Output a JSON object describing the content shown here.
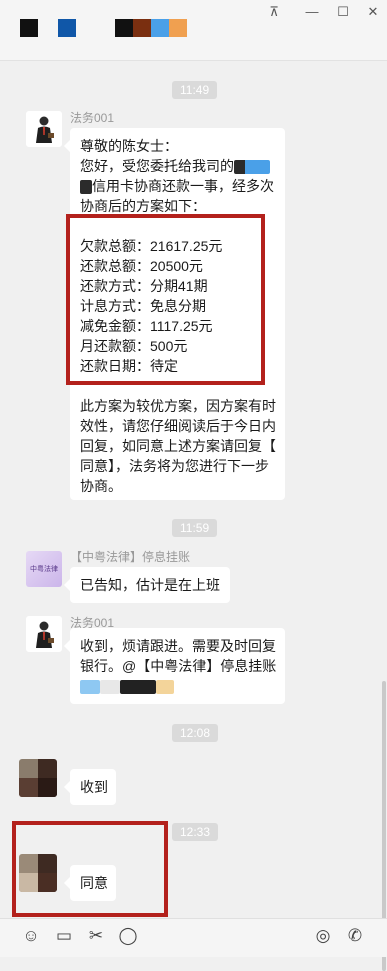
{
  "window": {
    "pin_glyph": "⊼",
    "minimize_glyph": "—",
    "maximize_glyph": "☐",
    "close_glyph": "✕"
  },
  "messages": {
    "time_1": "11:49",
    "time_2": "11:59",
    "time_3": "12:08",
    "time_4": "12:33",
    "sender_law": "法务001",
    "sender_group": "【中粤法律】停息挂账",
    "msg1": {
      "greeting": "尊敬的陈女士：",
      "line1": "您好，受您委托给我司的",
      "line2": "信用卡协商还款一事，经多次",
      "line3": "协商后的方案如下：",
      "plan": [
        "欠款总额：21617.25元",
        "还款总额：20500元",
        "还款方式：分期41期",
        "计息方式：免息分期",
        "减免金额：1117.25元",
        "月还款额：500元",
        "还款日期：待定"
      ],
      "tail": [
        "此方案为较优方案，因方案有时",
        "效性，请您仔细阅读后于今日内",
        "回复，如同意上述方案请回复【",
        "同意】，法务将为您进行下一步",
        "协商。"
      ]
    },
    "msg2": "已告知，估计是在上班",
    "msg3": {
      "line1": "收到，烦请跟进。需要及时回复",
      "line2": "银行。@【中粤法律】停息挂账"
    },
    "msg4": "收到",
    "msg5": "同意"
  },
  "icons": {
    "emoji": "☺",
    "folder": "▭",
    "scissors": "✂",
    "chat": "◯",
    "live": "◎",
    "video": "✆"
  },
  "group_avatar_text": "中粤法律",
  "colors": {
    "accent_red": "#b3211c",
    "time_bg": "#dadada"
  }
}
